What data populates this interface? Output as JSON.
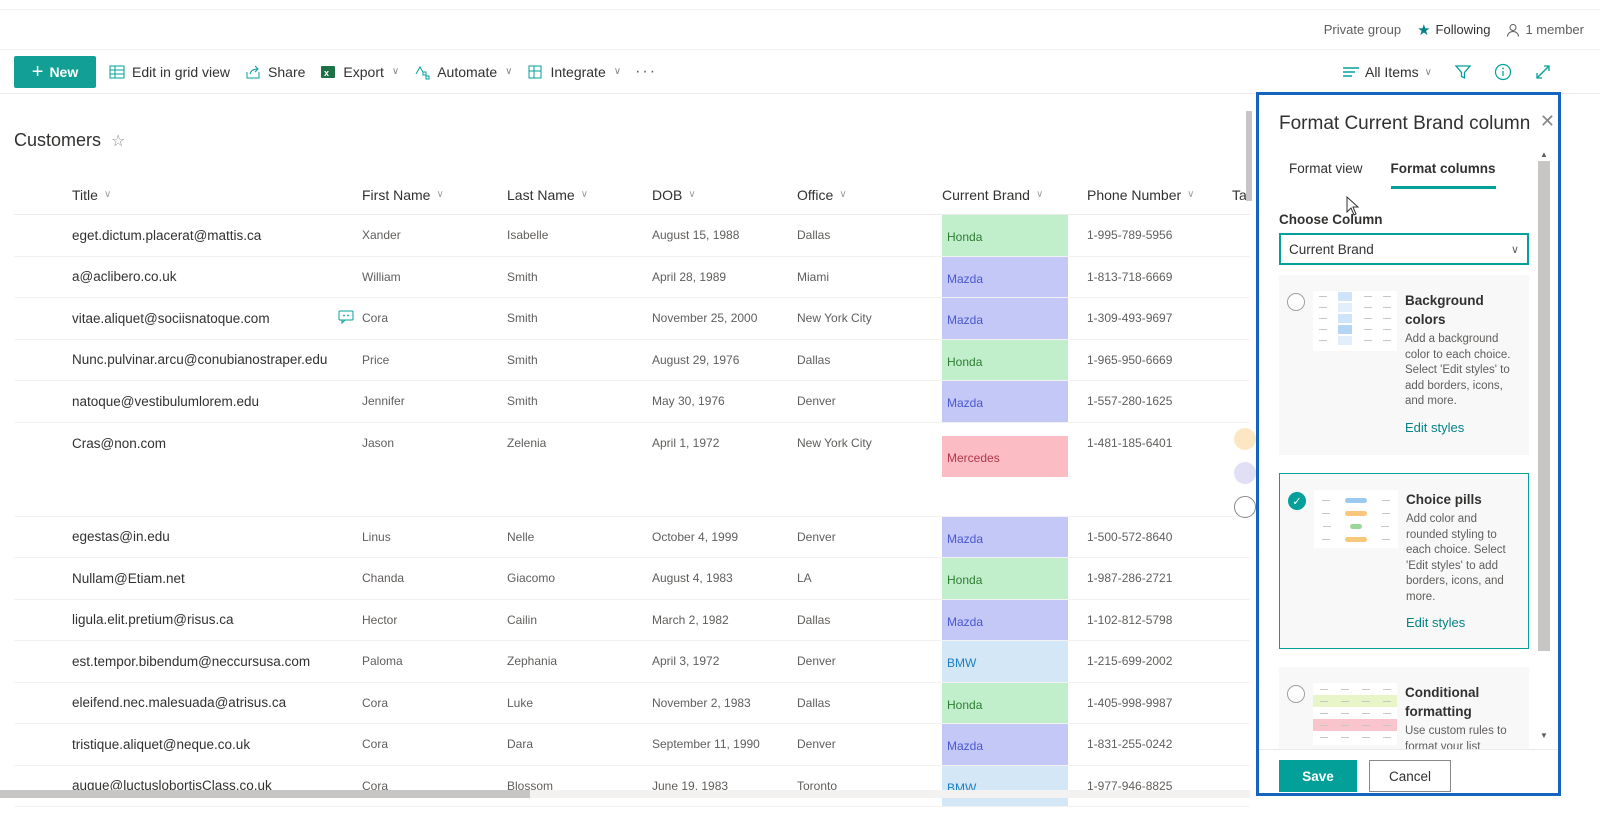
{
  "group_bar": {
    "privacy": "Private group",
    "following": "Following",
    "members": "1 member"
  },
  "command_bar": {
    "new": "New",
    "edit_grid": "Edit in grid view",
    "share": "Share",
    "export": "Export",
    "automate": "Automate",
    "integrate": "Integrate",
    "more": "···",
    "view": "All Items"
  },
  "list": {
    "title": "Customers",
    "columns": [
      "Title",
      "First Name",
      "Last Name",
      "DOB",
      "Office",
      "Current Brand",
      "Phone Number",
      "Ta"
    ],
    "rows": [
      {
        "title": "eget.dictum.placerat@mattis.ca",
        "first": "Xander",
        "last": "Isabelle",
        "dob": "August 15, 1988",
        "office": "Dallas",
        "brand": "Honda",
        "phone": "1-995-789-5956"
      },
      {
        "title": "a@aclibero.co.uk",
        "first": "William",
        "last": "Smith",
        "dob": "April 28, 1989",
        "office": "Miami",
        "brand": "Mazda",
        "phone": "1-813-718-6669"
      },
      {
        "title": "vitae.aliquet@sociisnatoque.com",
        "first": "Cora",
        "last": "Smith",
        "dob": "November 25, 2000",
        "office": "New York City",
        "brand": "Mazda",
        "phone": "1-309-493-9697",
        "comment": true
      },
      {
        "title": "Nunc.pulvinar.arcu@conubianostraper.edu",
        "first": "Price",
        "last": "Smith",
        "dob": "August 29, 1976",
        "office": "Dallas",
        "brand": "Honda",
        "phone": "1-965-950-6669"
      },
      {
        "title": "natoque@vestibulumlorem.edu",
        "first": "Jennifer",
        "last": "Smith",
        "dob": "May 30, 1976",
        "office": "Denver",
        "brand": "Mazda",
        "phone": "1-557-280-1625"
      },
      {
        "title": "Cras@non.com",
        "first": "Jason",
        "last": "Zelenia",
        "dob": "April 1, 1972",
        "office": "New York City",
        "brand": "Mercedes",
        "phone": "1-481-185-6401",
        "tall": true
      },
      {
        "title": "egestas@in.edu",
        "first": "Linus",
        "last": "Nelle",
        "dob": "October 4, 1999",
        "office": "Denver",
        "brand": "Mazda",
        "phone": "1-500-572-8640"
      },
      {
        "title": "Nullam@Etiam.net",
        "first": "Chanda",
        "last": "Giacomo",
        "dob": "August 4, 1983",
        "office": "LA",
        "brand": "Honda",
        "phone": "1-987-286-2721"
      },
      {
        "title": "ligula.elit.pretium@risus.ca",
        "first": "Hector",
        "last": "Cailin",
        "dob": "March 2, 1982",
        "office": "Dallas",
        "brand": "Mazda",
        "phone": "1-102-812-5798"
      },
      {
        "title": "est.tempor.bibendum@neccursusa.com",
        "first": "Paloma",
        "last": "Zephania",
        "dob": "April 3, 1972",
        "office": "Denver",
        "brand": "BMW",
        "phone": "1-215-699-2002"
      },
      {
        "title": "eleifend.nec.malesuada@atrisus.ca",
        "first": "Cora",
        "last": "Luke",
        "dob": "November 2, 1983",
        "office": "Dallas",
        "brand": "Honda",
        "phone": "1-405-998-9987"
      },
      {
        "title": "tristique.aliquet@neque.co.uk",
        "first": "Cora",
        "last": "Dara",
        "dob": "September 11, 1990",
        "office": "Denver",
        "brand": "Mazda",
        "phone": "1-831-255-0242"
      },
      {
        "title": "augue@luctuslobortisClass.co.uk",
        "first": "Cora",
        "last": "Blossom",
        "dob": "June 19, 1983",
        "office": "Toronto",
        "brand": "BMW",
        "phone": "1-977-946-8825"
      }
    ]
  },
  "brand_colors": {
    "Honda": {
      "bg": "#c1efcb",
      "fg": "#2e7d32"
    },
    "Mazda": {
      "bg": "#c3c8f7",
      "fg": "#4a57d0"
    },
    "Mercedes": {
      "bg": "#fbbcc4",
      "fg": "#b3374a"
    },
    "BMW": {
      "bg": "#d3e7f6",
      "fg": "#1b7fc4"
    }
  },
  "panel": {
    "title": "Format Current Brand column",
    "tabs": [
      "Format view",
      "Format columns"
    ],
    "active_tab": "Format columns",
    "choose_label": "Choose Column",
    "choose_value": "Current Brand",
    "options": [
      {
        "title": "Background colors",
        "desc": "Add a background color to each choice. Select 'Edit styles' to add borders, icons, and more.",
        "link": "Edit styles",
        "selected": false
      },
      {
        "title": "Choice pills",
        "desc": "Add color and rounded styling to each choice. Select 'Edit styles' to add borders, icons, and more.",
        "link": "Edit styles",
        "selected": true
      },
      {
        "title": "Conditional formatting",
        "desc": "Use custom rules to format your list",
        "selected": false
      }
    ],
    "save": "Save",
    "cancel": "Cancel"
  },
  "accent": "#03a09a"
}
